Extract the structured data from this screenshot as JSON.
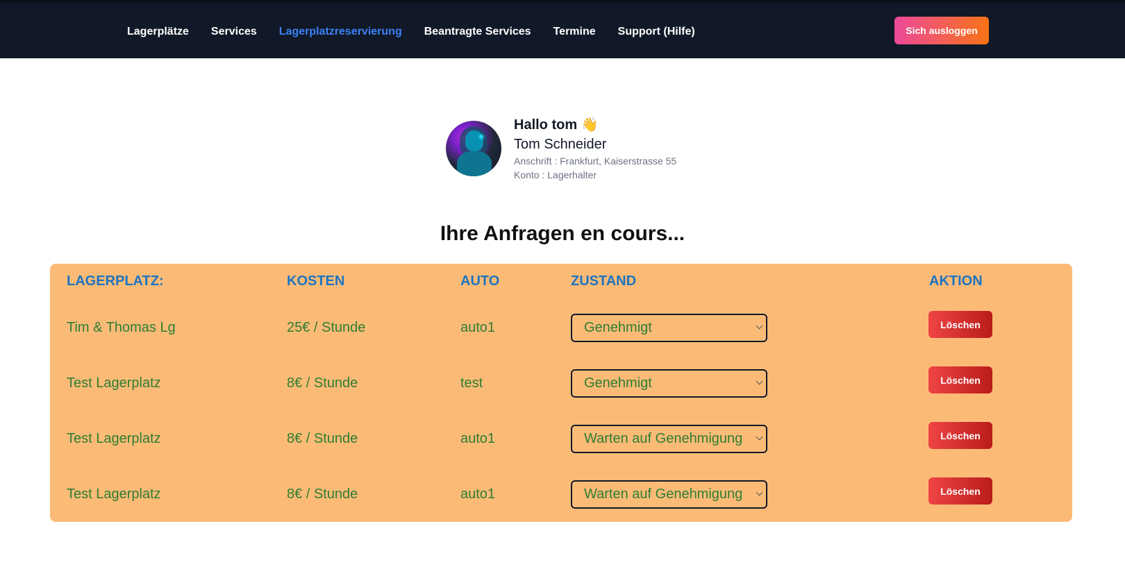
{
  "nav": {
    "items": [
      {
        "label": "Lagerplätze"
      },
      {
        "label": "Services"
      },
      {
        "label": "Lagerplatzreservierung"
      },
      {
        "label": "Beantragte Services"
      },
      {
        "label": "Termine"
      },
      {
        "label": "Support (Hilfe)"
      }
    ],
    "active_index": 2,
    "logout_label": "Sich ausloggen"
  },
  "profile": {
    "greeting": "Hallo tom 👋",
    "name": "Tom Schneider",
    "address": "Anschrift : Frankfurt, Kaiserstrasse 55",
    "account": "Konto : Lagerhalter"
  },
  "page": {
    "heading": "Ihre Anfragen en cours..."
  },
  "table": {
    "headers": {
      "lagerplatz": "Lagerplatz:",
      "kosten": "Kosten",
      "auto": "Auto",
      "zustand": "Zustand",
      "aktion": "Aktion"
    },
    "rows": [
      {
        "lagerplatz": "Tim & Thomas Lg",
        "kosten": "25€ / Stunde",
        "auto": "auto1",
        "zustand": "Genehmigt",
        "action": "Löschen"
      },
      {
        "lagerplatz": "Test Lagerplatz",
        "kosten": "8€ / Stunde",
        "auto": "test",
        "zustand": "Genehmigt",
        "action": "Löschen"
      },
      {
        "lagerplatz": "Test Lagerplatz",
        "kosten": "8€ / Stunde",
        "auto": "auto1",
        "zustand": "Warten auf Genehmigung",
        "action": "Löschen"
      },
      {
        "lagerplatz": "Test Lagerplatz",
        "kosten": "8€ / Stunde",
        "auto": "auto1",
        "zustand": "Warten auf Genehmigung",
        "action": "Löschen"
      }
    ]
  },
  "colors": {
    "topbar": "#111827",
    "nav_active": "#3b82f6",
    "panel": "#fbbb77",
    "header_text": "#1d74c0",
    "cell_text": "#2e7d32",
    "delete_button": "#dc2626"
  }
}
